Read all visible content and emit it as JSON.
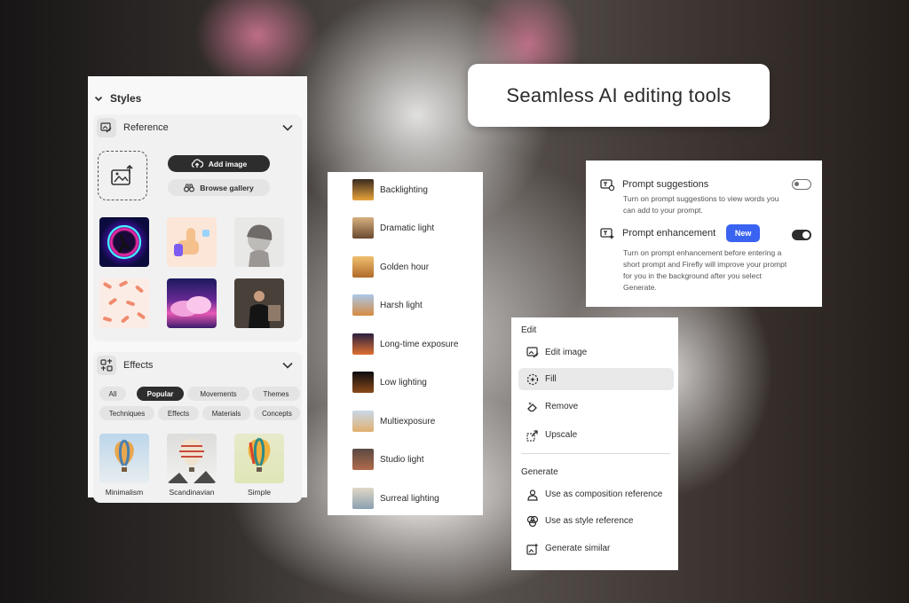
{
  "headline": "Seamless AI editing tools",
  "styles_panel": {
    "title": "Styles",
    "reference": {
      "label": "Reference",
      "add_image": "Add image",
      "browse_gallery": "Browse gallery"
    },
    "effects": {
      "label": "Effects",
      "tags": [
        "All",
        "Popular",
        "Movements",
        "Themes",
        "Techniques",
        "Effects",
        "Materials",
        "Concepts"
      ],
      "selected_tag": "Popular",
      "thumbs": [
        "Minimalism",
        "Scandinavian",
        "Simple"
      ]
    }
  },
  "lighting_list": {
    "items": [
      "Backlighting",
      "Dramatic light",
      "Golden hour",
      "Harsh light",
      "Long-time exposure",
      "Low lighting",
      "Multiexposure",
      "Studio light",
      "Surreal lighting"
    ]
  },
  "prompt_settings": {
    "suggestions": {
      "title": "Prompt suggestions",
      "description": "Turn on prompt suggestions to view words you can add to your prompt.",
      "enabled": false
    },
    "enhancement": {
      "title": "Prompt enhancement",
      "badge": "New",
      "description": "Turn on prompt enhancement before entering a short prompt and Firefly will improve your prompt for you in the background after you select Generate.",
      "enabled": true
    }
  },
  "edit_menu": {
    "edit_header": "Edit",
    "edit_items": [
      "Edit image",
      "Fill",
      "Remove",
      "Upscale"
    ],
    "active_item": "Fill",
    "generate_header": "Generate",
    "generate_items": [
      "Use as composition reference",
      "Use as style reference",
      "Generate similar"
    ]
  },
  "colors": {
    "accent_blue": "#3a63f1",
    "dark_button": "#2d2d2d"
  }
}
